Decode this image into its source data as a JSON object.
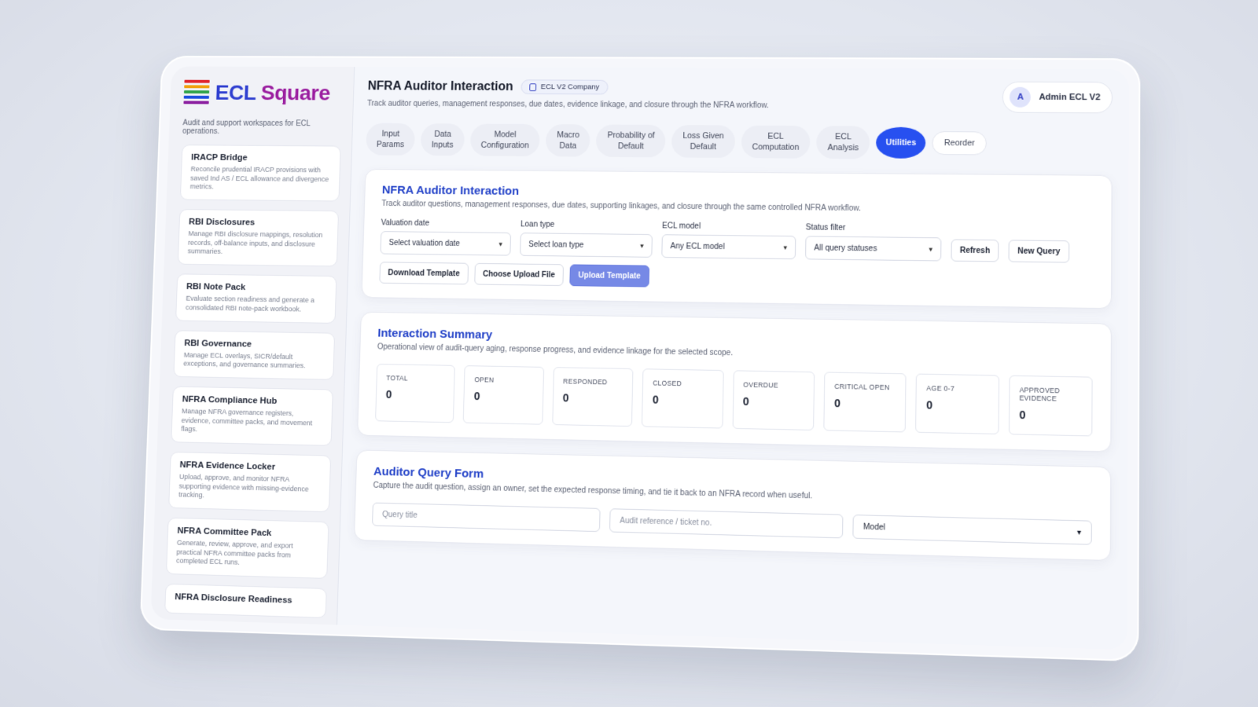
{
  "brand": {
    "logo_ecl": "ECL",
    "logo_square": "Square",
    "tagline": "Audit and support workspaces for ECL operations.",
    "logo_colors": [
      "#e0242d",
      "#f1a10f",
      "#2fa34a",
      "#1f4fe0",
      "#8b1fa0"
    ]
  },
  "sidebar": {
    "items": [
      {
        "title": "IRACP Bridge",
        "desc": "Reconcile prudential IRACP provisions with saved Ind AS / ECL allowance and divergence metrics."
      },
      {
        "title": "RBI Disclosures",
        "desc": "Manage RBI disclosure mappings, resolution records, off-balance inputs, and disclosure summaries."
      },
      {
        "title": "RBI Note Pack",
        "desc": "Evaluate section readiness and generate a consolidated RBI note-pack workbook."
      },
      {
        "title": "RBI Governance",
        "desc": "Manage ECL overlays, SICR/default exceptions, and governance summaries."
      },
      {
        "title": "NFRA Compliance Hub",
        "desc": "Manage NFRA governance registers, evidence, committee packs, and movement flags."
      },
      {
        "title": "NFRA Evidence Locker",
        "desc": "Upload, approve, and monitor NFRA supporting evidence with missing-evidence tracking."
      },
      {
        "title": "NFRA Committee Pack",
        "desc": "Generate, review, approve, and export practical NFRA committee packs from completed ECL runs."
      },
      {
        "title": "NFRA Disclosure Readiness",
        "desc": ""
      }
    ]
  },
  "header": {
    "title": "NFRA Auditor Interaction",
    "company": "ECL V2 Company",
    "subtitle": "Track auditor queries, management responses, due dates, evidence linkage, and closure through the NFRA workflow.",
    "user_initial": "A",
    "user_name": "Admin ECL V2"
  },
  "tabs": [
    {
      "label": "Input\nParams"
    },
    {
      "label": "Data\nInputs"
    },
    {
      "label": "Model\nConfiguration"
    },
    {
      "label": "Macro\nData"
    },
    {
      "label": "Probability of\nDefault"
    },
    {
      "label": "Loss Given\nDefault"
    },
    {
      "label": "ECL\nComputation"
    },
    {
      "label": "ECL\nAnalysis"
    },
    {
      "label": "Utilities"
    },
    {
      "label": "Reorder"
    }
  ],
  "interaction": {
    "title": "NFRA Auditor Interaction",
    "subtitle": "Track auditor questions, management responses, due dates, supporting linkages, and closure through the same controlled NFRA workflow.",
    "filters": [
      {
        "label": "Valuation date",
        "value": "Select valuation date"
      },
      {
        "label": "Loan type",
        "value": "Select loan type"
      },
      {
        "label": "ECL model",
        "value": "Any ECL model"
      },
      {
        "label": "Status filter",
        "value": "All query statuses"
      }
    ],
    "refresh": "Refresh",
    "new_query": "New Query",
    "download_template": "Download Template",
    "choose_file": "Choose Upload File",
    "upload_template": "Upload Template"
  },
  "summary": {
    "title": "Interaction Summary",
    "subtitle": "Operational view of audit-query aging, response progress, and evidence linkage for the selected scope.",
    "kpis": [
      {
        "label": "TOTAL",
        "value": "0"
      },
      {
        "label": "OPEN",
        "value": "0"
      },
      {
        "label": "RESPONDED",
        "value": "0"
      },
      {
        "label": "CLOSED",
        "value": "0"
      },
      {
        "label": "OVERDUE",
        "value": "0"
      },
      {
        "label": "CRITICAL OPEN",
        "value": "0"
      },
      {
        "label": "AGE 0-7",
        "value": "0"
      },
      {
        "label": "APPROVED EVIDENCE",
        "value": "0"
      }
    ]
  },
  "query_form": {
    "title": "Auditor Query Form",
    "subtitle": "Capture the audit question, assign an owner, set the expected response timing, and tie it back to an NFRA record when useful.",
    "query_title_placeholder": "Query title",
    "audit_ref_placeholder": "Audit reference / ticket no.",
    "model_value": "Model"
  }
}
